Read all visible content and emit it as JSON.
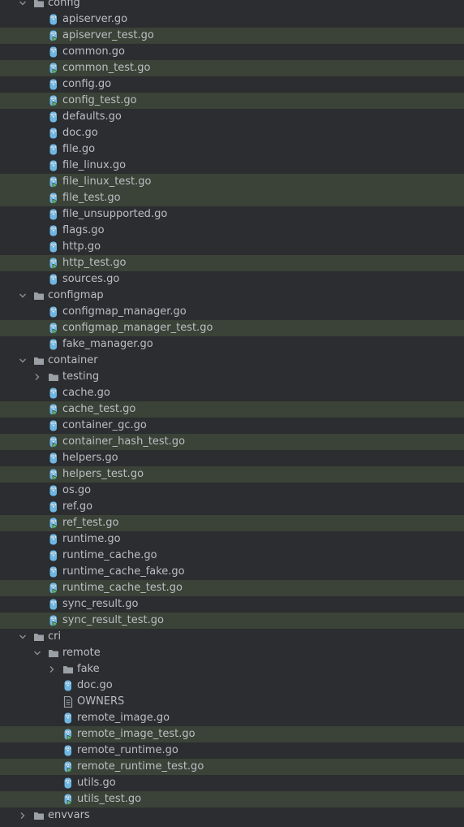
{
  "tree": [
    {
      "label": "config",
      "type": "folder",
      "depth": 0,
      "expanded": true
    },
    {
      "label": "apiserver.go",
      "type": "go",
      "depth": 1
    },
    {
      "label": "apiserver_test.go",
      "type": "test",
      "depth": 1
    },
    {
      "label": "common.go",
      "type": "go",
      "depth": 1
    },
    {
      "label": "common_test.go",
      "type": "test",
      "depth": 1
    },
    {
      "label": "config.go",
      "type": "go",
      "depth": 1
    },
    {
      "label": "config_test.go",
      "type": "test",
      "depth": 1
    },
    {
      "label": "defaults.go",
      "type": "go",
      "depth": 1
    },
    {
      "label": "doc.go",
      "type": "go",
      "depth": 1
    },
    {
      "label": "file.go",
      "type": "go",
      "depth": 1
    },
    {
      "label": "file_linux.go",
      "type": "go",
      "depth": 1
    },
    {
      "label": "file_linux_test.go",
      "type": "test",
      "depth": 1
    },
    {
      "label": "file_test.go",
      "type": "test",
      "depth": 1
    },
    {
      "label": "file_unsupported.go",
      "type": "go",
      "depth": 1
    },
    {
      "label": "flags.go",
      "type": "go",
      "depth": 1
    },
    {
      "label": "http.go",
      "type": "go",
      "depth": 1
    },
    {
      "label": "http_test.go",
      "type": "test",
      "depth": 1
    },
    {
      "label": "sources.go",
      "type": "go",
      "depth": 1
    },
    {
      "label": "configmap",
      "type": "folder",
      "depth": 0,
      "expanded": true
    },
    {
      "label": "configmap_manager.go",
      "type": "go",
      "depth": 1
    },
    {
      "label": "configmap_manager_test.go",
      "type": "test",
      "depth": 1
    },
    {
      "label": "fake_manager.go",
      "type": "go",
      "depth": 1
    },
    {
      "label": "container",
      "type": "folder",
      "depth": 0,
      "expanded": true
    },
    {
      "label": "testing",
      "type": "folder",
      "depth": 1,
      "expanded": false
    },
    {
      "label": "cache.go",
      "type": "go",
      "depth": 1
    },
    {
      "label": "cache_test.go",
      "type": "test",
      "depth": 1
    },
    {
      "label": "container_gc.go",
      "type": "go",
      "depth": 1
    },
    {
      "label": "container_hash_test.go",
      "type": "test",
      "depth": 1
    },
    {
      "label": "helpers.go",
      "type": "go",
      "depth": 1
    },
    {
      "label": "helpers_test.go",
      "type": "test",
      "depth": 1
    },
    {
      "label": "os.go",
      "type": "go",
      "depth": 1
    },
    {
      "label": "ref.go",
      "type": "go",
      "depth": 1
    },
    {
      "label": "ref_test.go",
      "type": "test",
      "depth": 1
    },
    {
      "label": "runtime.go",
      "type": "go",
      "depth": 1
    },
    {
      "label": "runtime_cache.go",
      "type": "go",
      "depth": 1
    },
    {
      "label": "runtime_cache_fake.go",
      "type": "go",
      "depth": 1
    },
    {
      "label": "runtime_cache_test.go",
      "type": "test",
      "depth": 1
    },
    {
      "label": "sync_result.go",
      "type": "go",
      "depth": 1
    },
    {
      "label": "sync_result_test.go",
      "type": "test",
      "depth": 1
    },
    {
      "label": "cri",
      "type": "folder",
      "depth": 0,
      "expanded": true
    },
    {
      "label": "remote",
      "type": "folder",
      "depth": 1,
      "expanded": true
    },
    {
      "label": "fake",
      "type": "folder",
      "depth": 2,
      "expanded": false
    },
    {
      "label": "doc.go",
      "type": "go",
      "depth": 2
    },
    {
      "label": "OWNERS",
      "type": "text",
      "depth": 2
    },
    {
      "label": "remote_image.go",
      "type": "go",
      "depth": 2
    },
    {
      "label": "remote_image_test.go",
      "type": "test",
      "depth": 2
    },
    {
      "label": "remote_runtime.go",
      "type": "go",
      "depth": 2
    },
    {
      "label": "remote_runtime_test.go",
      "type": "test",
      "depth": 2
    },
    {
      "label": "utils.go",
      "type": "go",
      "depth": 2
    },
    {
      "label": "utils_test.go",
      "type": "test",
      "depth": 2
    },
    {
      "label": "envvars",
      "type": "folder",
      "depth": 0,
      "expanded": false
    }
  ],
  "colors": {
    "background": "#2b2d30",
    "test_row": "#3b4237",
    "text": "#bcbec4",
    "folder": "#9aa0a6",
    "go_icon": "#6fb6e3",
    "test_arrow": "#5fb865"
  }
}
